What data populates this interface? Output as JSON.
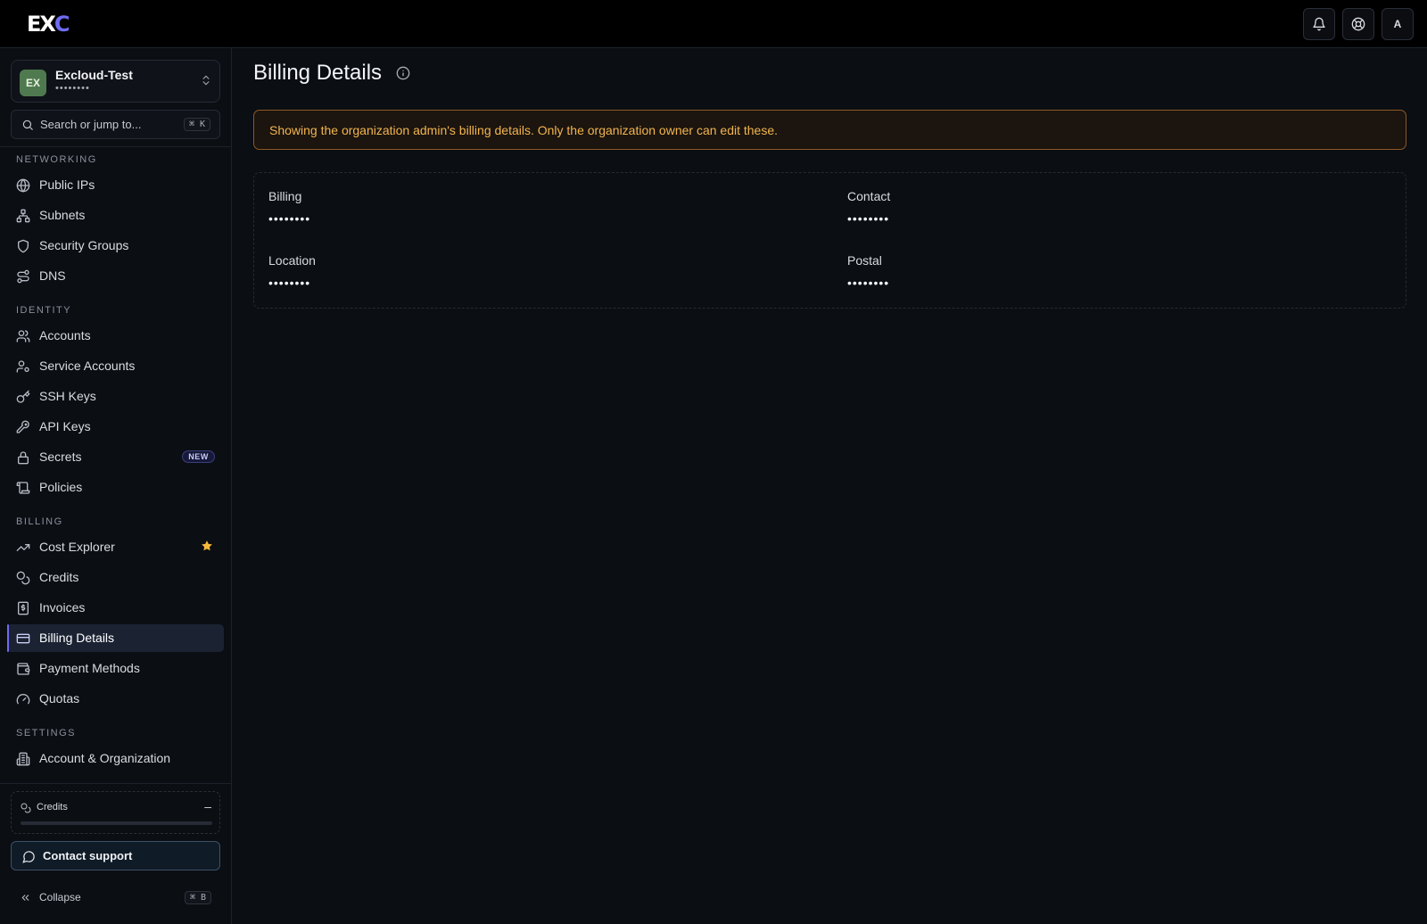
{
  "app": {
    "logo_main": "EX",
    "logo_accent": "C"
  },
  "header": {
    "avatar_letter": "A",
    "icons": [
      "bell-icon",
      "lifebuoy-icon"
    ]
  },
  "org": {
    "initials": "EX",
    "name": "Excloud-Test",
    "masked_id": "••••••••"
  },
  "search": {
    "placeholder": "Search or jump to...",
    "shortcut": "⌘ K"
  },
  "sidebar": {
    "sections": {
      "networking": "NETWORKING",
      "identity": "IDENTITY",
      "billing": "BILLING",
      "settings": "SETTINGS"
    },
    "networking": [
      "Public IPs",
      "Subnets",
      "Security Groups",
      "DNS"
    ],
    "identity": [
      "Accounts",
      "Service Accounts",
      "SSH Keys",
      "API Keys",
      "Secrets",
      "Policies"
    ],
    "billing": [
      "Cost Explorer",
      "Credits",
      "Invoices",
      "Billing Details",
      "Payment Methods",
      "Quotas"
    ],
    "settings": [
      "Account & Organization"
    ],
    "new_badge": "NEW",
    "active_item": "Billing Details"
  },
  "credits_widget": {
    "label": "Credits",
    "value": "–",
    "progress": 0
  },
  "contact_support": "Contact support",
  "collapse": {
    "label": "Collapse",
    "shortcut": "⌘ B"
  },
  "main": {
    "title": "Billing Details",
    "alert": "Showing the organization admin's billing details. Only the organization owner can edit these.",
    "fields": {
      "billing": {
        "label": "Billing",
        "value": "••••••••"
      },
      "contact": {
        "label": "Contact",
        "value": "••••••••"
      },
      "location": {
        "label": "Location",
        "value": "••••••••"
      },
      "postal": {
        "label": "Postal",
        "value": "••••••••"
      }
    }
  },
  "colors": {
    "accent": "#6f6cf2",
    "alert_border": "#8d5a24",
    "alert_text": "#f2b54e",
    "star": "#f5b93a"
  }
}
